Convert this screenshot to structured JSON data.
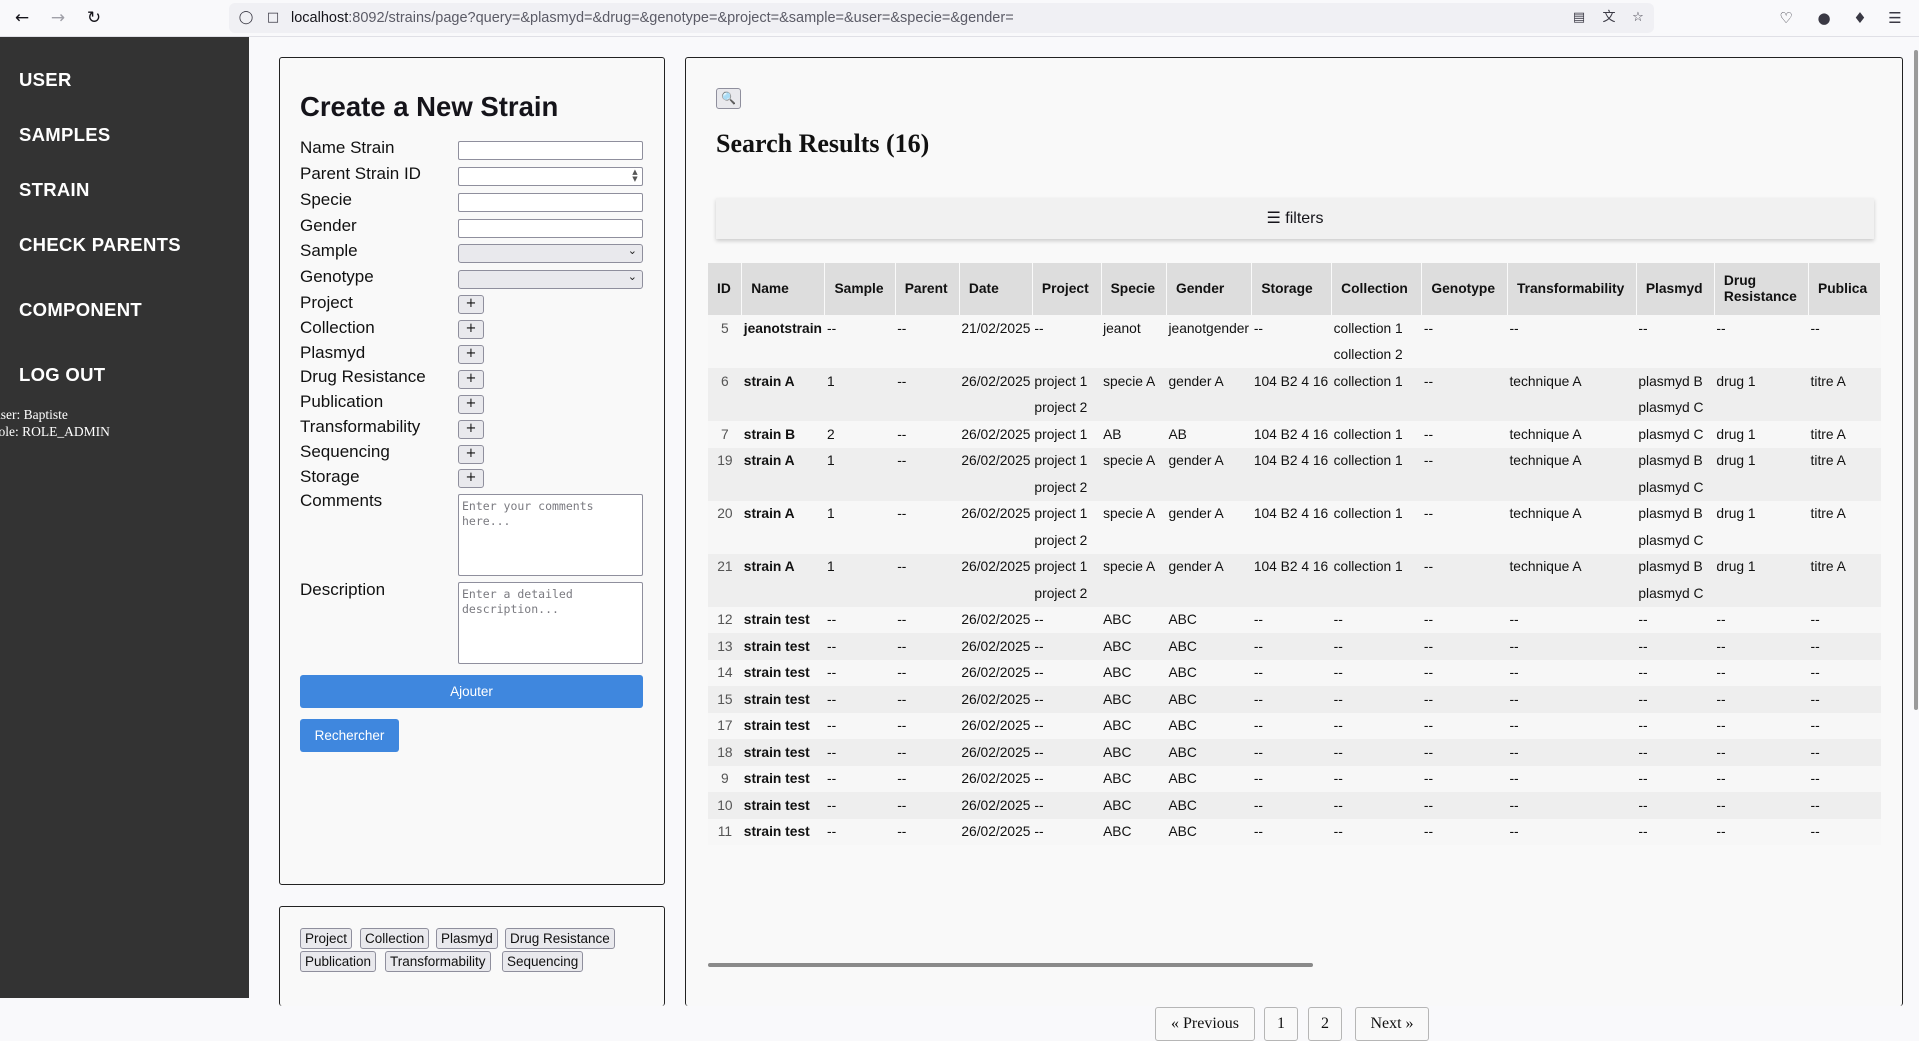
{
  "browser": {
    "url_host": "localhost",
    "url_rest": ":8092/strains/page?query=&plasmyd=&drug=&genotype=&project=&sample=&user=&specie=&gender="
  },
  "sidebar": {
    "items": [
      {
        "label": "USER"
      },
      {
        "label": "SAMPLES"
      },
      {
        "label": "STRAIN"
      },
      {
        "label": "CHECK PARENTS"
      },
      {
        "label": "COMPONENT"
      },
      {
        "label": "LOG OUT"
      }
    ],
    "user_line": "user: Baptiste",
    "role_line": "role: ROLE_ADMIN"
  },
  "form": {
    "title": "Create a New Strain",
    "labels": {
      "name": "Name Strain",
      "parent": "Parent Strain ID",
      "specie": "Specie",
      "gender": "Gender",
      "sample": "Sample",
      "genotype": "Genotype",
      "project": "Project",
      "collection": "Collection",
      "plasmyd": "Plasmyd",
      "drug": "Drug Resistance",
      "publication": "Publication",
      "transformability": "Transformability",
      "sequencing": "Sequencing",
      "storage": "Storage",
      "comments": "Comments",
      "description": "Description"
    },
    "plus_label": "+",
    "comments_placeholder": "Enter your comments\nhere...",
    "description_placeholder": "Enter a detailed\ndescription...",
    "submit_label": "Ajouter",
    "search_label": "Rechercher"
  },
  "tags": {
    "row1": [
      "Project",
      "Collection",
      "Plasmyd",
      "Drug Resistance"
    ],
    "row2": [
      "Publication",
      "Transformability",
      "Sequencing"
    ]
  },
  "results": {
    "search_icon": "magnifier-icon",
    "title": "Search Results (16)",
    "filters_label": "☰ filters",
    "columns": [
      "ID",
      "Name",
      "Sample",
      "Parent",
      "Date",
      "Project",
      "Specie",
      "Gender",
      "Storage",
      "Collection",
      "Genotype",
      "Transformability",
      "Plasmyd",
      "Drug\nResistance",
      "Publica"
    ],
    "rows": [
      {
        "cells": [
          "5",
          "jeanotstrain",
          "--",
          "--",
          "21/02/2025",
          "--",
          "jeanot",
          "jeanotgender",
          "--",
          "collection 1",
          "--",
          "--",
          "--",
          "--",
          "--"
        ],
        "extra": {
          "project": "",
          "collection": "collection 2",
          "plasmyd": ""
        }
      },
      {
        "cells": [
          "6",
          "strain A",
          "1",
          "--",
          "26/02/2025",
          "project 1",
          "specie A",
          "gender A",
          "104 B2 4 16",
          "collection 1",
          "--",
          "technique A",
          "plasmyd B",
          "drug 1",
          "titre A"
        ],
        "extra": {
          "project": "project 2",
          "collection": "",
          "plasmyd": "plasmyd C"
        }
      },
      {
        "cells": [
          "7",
          "strain B",
          "2",
          "--",
          "26/02/2025",
          "project 1",
          "AB",
          "AB",
          "104 B2 4 16",
          "collection 1",
          "--",
          "technique A",
          "plasmyd C",
          "drug 1",
          "titre A"
        ]
      },
      {
        "cells": [
          "19",
          "strain A",
          "1",
          "--",
          "26/02/2025",
          "project 1",
          "specie A",
          "gender A",
          "104 B2 4 16",
          "collection 1",
          "--",
          "technique A",
          "plasmyd B",
          "drug 1",
          "titre A"
        ],
        "extra": {
          "project": "project 2",
          "collection": "",
          "plasmyd": "plasmyd C"
        }
      },
      {
        "cells": [
          "20",
          "strain A",
          "1",
          "--",
          "26/02/2025",
          "project 1",
          "specie A",
          "gender A",
          "104 B2 4 16",
          "collection 1",
          "--",
          "technique A",
          "plasmyd B",
          "drug 1",
          "titre A"
        ],
        "extra": {
          "project": "project 2",
          "collection": "",
          "plasmyd": "plasmyd C"
        }
      },
      {
        "cells": [
          "21",
          "strain A",
          "1",
          "--",
          "26/02/2025",
          "project 1",
          "specie A",
          "gender A",
          "104 B2 4 16",
          "collection 1",
          "--",
          "technique A",
          "plasmyd B",
          "drug 1",
          "titre A"
        ],
        "extra": {
          "project": "project 2",
          "collection": "",
          "plasmyd": "plasmyd C"
        }
      },
      {
        "cells": [
          "12",
          "strain test",
          "--",
          "--",
          "26/02/2025",
          "--",
          "ABC",
          "ABC",
          "--",
          "--",
          "--",
          "--",
          "--",
          "--",
          "--"
        ]
      },
      {
        "cells": [
          "13",
          "strain test",
          "--",
          "--",
          "26/02/2025",
          "--",
          "ABC",
          "ABC",
          "--",
          "--",
          "--",
          "--",
          "--",
          "--",
          "--"
        ]
      },
      {
        "cells": [
          "14",
          "strain test",
          "--",
          "--",
          "26/02/2025",
          "--",
          "ABC",
          "ABC",
          "--",
          "--",
          "--",
          "--",
          "--",
          "--",
          "--"
        ]
      },
      {
        "cells": [
          "15",
          "strain test",
          "--",
          "--",
          "26/02/2025",
          "--",
          "ABC",
          "ABC",
          "--",
          "--",
          "--",
          "--",
          "--",
          "--",
          "--"
        ]
      },
      {
        "cells": [
          "17",
          "strain test",
          "--",
          "--",
          "26/02/2025",
          "--",
          "ABC",
          "ABC",
          "--",
          "--",
          "--",
          "--",
          "--",
          "--",
          "--"
        ]
      },
      {
        "cells": [
          "18",
          "strain test",
          "--",
          "--",
          "26/02/2025",
          "--",
          "ABC",
          "ABC",
          "--",
          "--",
          "--",
          "--",
          "--",
          "--",
          "--"
        ]
      },
      {
        "cells": [
          "9",
          "strain test",
          "--",
          "--",
          "26/02/2025",
          "--",
          "ABC",
          "ABC",
          "--",
          "--",
          "--",
          "--",
          "--",
          "--",
          "--"
        ]
      },
      {
        "cells": [
          "10",
          "strain test",
          "--",
          "--",
          "26/02/2025",
          "--",
          "ABC",
          "ABC",
          "--",
          "--",
          "--",
          "--",
          "--",
          "--",
          "--"
        ]
      },
      {
        "cells": [
          "11",
          "strain test",
          "--",
          "--",
          "26/02/2025",
          "--",
          "ABC",
          "ABC",
          "--",
          "--",
          "--",
          "--",
          "--",
          "--",
          "--"
        ]
      }
    ]
  },
  "pagination": {
    "previous": "« Previous",
    "pages": [
      "1",
      "2"
    ],
    "next": "Next »"
  }
}
